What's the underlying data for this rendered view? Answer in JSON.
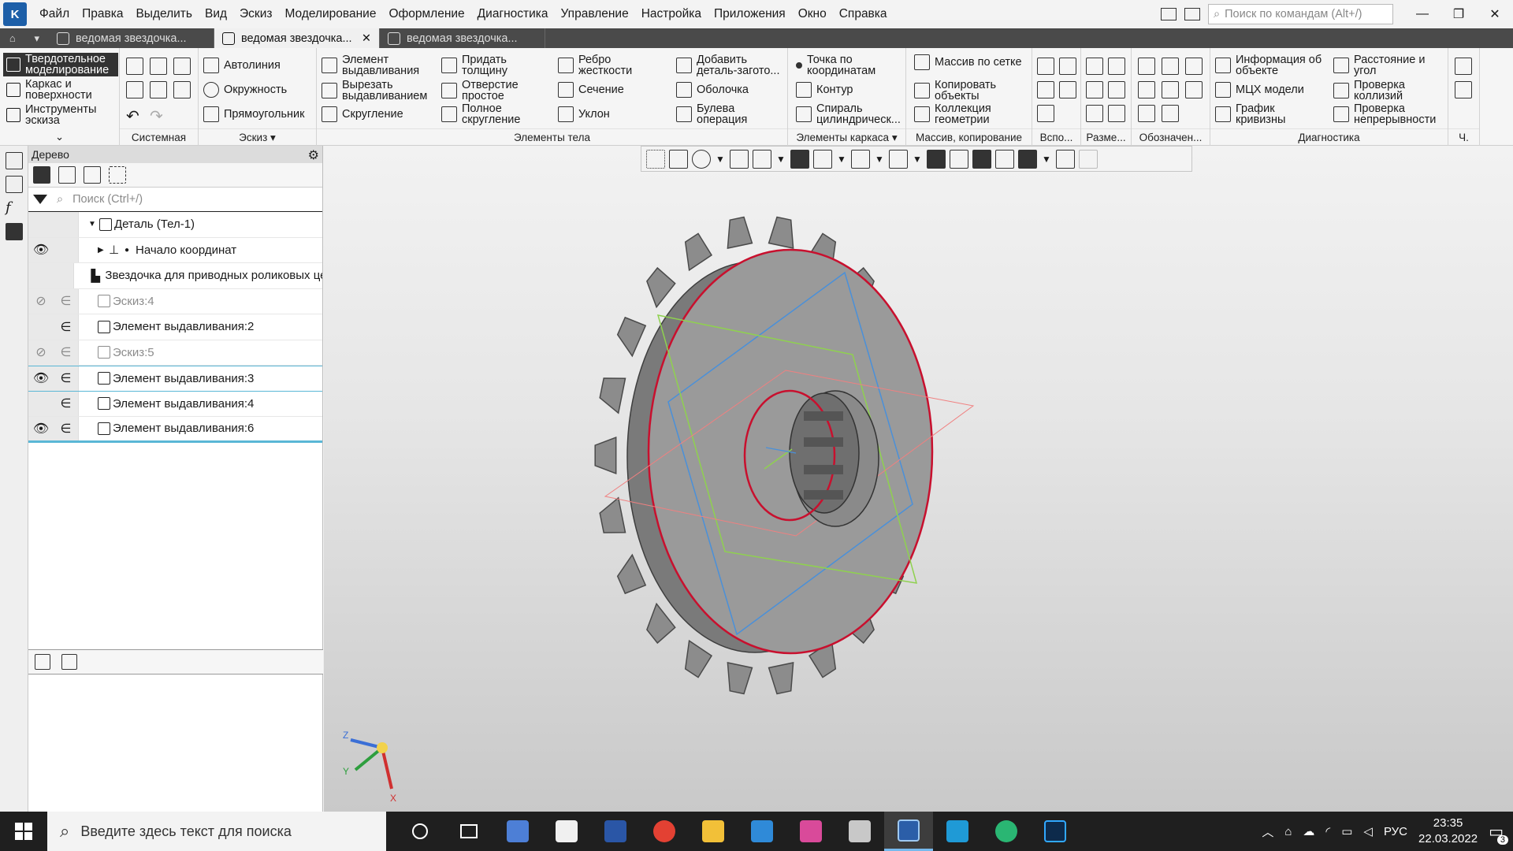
{
  "menu": {
    "items": [
      "Файл",
      "Правка",
      "Выделить",
      "Вид",
      "Эскиз",
      "Моделирование",
      "Оформление",
      "Диагностика",
      "Управление",
      "Настройка",
      "Приложения",
      "Окно",
      "Справка"
    ],
    "search_placeholder": "Поиск по командам (Alt+/)"
  },
  "tabs": [
    {
      "label": "ведомая звездочка..."
    },
    {
      "label": "ведомая звездочка...",
      "active": true
    },
    {
      "label": "ведомая звездочка..."
    }
  ],
  "ribbon": {
    "modes": [
      "Твердотельное моделирование",
      "Каркас и поверхности",
      "Инструменты эскиза"
    ],
    "groups": {
      "system": "Системная",
      "sketch": "Эскиз",
      "body": "Элементы тела",
      "frame": "Элементы каркаса",
      "array": "Массив, копирование",
      "aux": "Вспо...",
      "dim": "Разме...",
      "notation": "Обозначен...",
      "diag": "Диагностика",
      "ch": "Ч."
    },
    "sketch_items": [
      "Автолиния",
      "Окружность",
      "Прямоугольник"
    ],
    "body_items": [
      "Элемент выдавливания",
      "Вырезать выдавливанием",
      "Скругление",
      "Придать толщину",
      "Отверстие простое",
      "Полное скругление",
      "Ребро жесткости",
      "Сечение",
      "Уклон",
      "Добавить деталь-загото...",
      "Оболочка",
      "Булева операция"
    ],
    "frame_items": [
      "Точка по координатам",
      "Контур",
      "Спираль цилиндрическ..."
    ],
    "array_items": [
      "Массив по сетке",
      "Копировать объекты",
      "Коллекция геометрии"
    ],
    "diag_items": [
      "Информация об объекте",
      "МЦХ модели",
      "График кривизны",
      "Расстояние и угол",
      "Проверка коллизий",
      "Проверка непрерывности"
    ]
  },
  "tree": {
    "title": "Дерево",
    "search_placeholder": "Поиск (Ctrl+/)",
    "rows": [
      {
        "label": "Деталь (Тел-1)"
      },
      {
        "label": "Начало координат"
      },
      {
        "label": "Звездочка для приводных роликовых цепей"
      },
      {
        "label": "Эскиз:4"
      },
      {
        "label": "Элемент выдавливания:2"
      },
      {
        "label": "Эскиз:5"
      },
      {
        "label": "Элемент выдавливания:3"
      },
      {
        "label": "Элемент выдавливания:4"
      },
      {
        "label": "Элемент выдавливания:6"
      }
    ]
  },
  "triad": {
    "z": "Z",
    "y": "Y",
    "x": "X"
  },
  "taskbar": {
    "search_placeholder": "Введите здесь текст для поиска",
    "lang": "РУС",
    "time": "23:35",
    "date": "22.03.2022",
    "notifications": "3"
  },
  "colors": {
    "accent": "#1d5fa8",
    "highlight": "#5ab7d6",
    "edge": "#c8102e"
  }
}
